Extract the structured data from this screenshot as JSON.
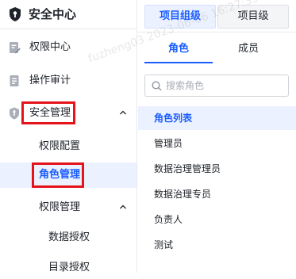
{
  "sidebar": {
    "title": "安全中心",
    "items": [
      {
        "label": "权限中心",
        "icon": "permission-doc-icon"
      },
      {
        "label": "操作审计",
        "icon": "audit-doc-icon"
      },
      {
        "label": "安全管理",
        "icon": "shield-icon",
        "expanded": true
      },
      {
        "label": "权限配置"
      },
      {
        "label": "角色管理",
        "active": true
      },
      {
        "label": "权限管理",
        "expanded": true
      },
      {
        "label": "数据授权"
      },
      {
        "label": "目录授权"
      }
    ]
  },
  "panel": {
    "top_tabs": [
      {
        "label": "项目组级",
        "active": true
      },
      {
        "label": "项目级",
        "active": false
      }
    ],
    "sub_tabs": [
      {
        "label": "角色",
        "active": true
      },
      {
        "label": "成员",
        "active": false
      }
    ],
    "search": {
      "placeholder": "搜索角色",
      "value": ""
    },
    "roles": [
      "角色列表",
      "管理员",
      "数据治理管理员",
      "数据治理专员",
      "负责人",
      "测试"
    ]
  },
  "watermark": "fuzheng03 2023-06-06 16:27:39",
  "colors": {
    "accent": "#1a5dff",
    "highlight_box": "#e5131a",
    "active_bg": "#ebf1ff"
  }
}
